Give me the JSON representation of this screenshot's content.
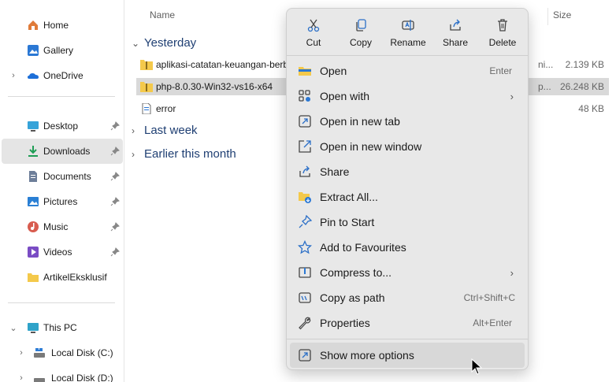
{
  "sidebar": {
    "items": [
      {
        "label": "Home",
        "icon": "home-icon"
      },
      {
        "label": "Gallery",
        "icon": "gallery-icon"
      },
      {
        "label": "OneDrive",
        "icon": "onedrive-icon"
      },
      {
        "label": "Desktop",
        "icon": "desktop-icon"
      },
      {
        "label": "Downloads",
        "icon": "downloads-icon"
      },
      {
        "label": "Documents",
        "icon": "documents-icon"
      },
      {
        "label": "Pictures",
        "icon": "pictures-icon"
      },
      {
        "label": "Music",
        "icon": "music-icon"
      },
      {
        "label": "Videos",
        "icon": "videos-icon"
      },
      {
        "label": "ArtikelEksklusif",
        "icon": "folder-icon"
      },
      {
        "label": "This PC",
        "icon": "this-pc-icon"
      },
      {
        "label": "Local Disk (C:)",
        "icon": "drive-icon"
      },
      {
        "label": "Local Disk (D:)",
        "icon": "drive-icon"
      }
    ]
  },
  "content": {
    "columns": {
      "name": "Name",
      "size": "Size"
    },
    "groups": [
      {
        "label": "Yesterday"
      },
      {
        "label": "Last week"
      },
      {
        "label": "Earlier this month"
      }
    ],
    "files": [
      {
        "name": "aplikasi-catatan-keuangan-berb",
        "type": "ni...",
        "size": "2.139 KB"
      },
      {
        "name": "php-8.0.30-Win32-vs16-x64",
        "type": "p...",
        "size": "26.248 KB"
      },
      {
        "name": "error",
        "type": "",
        "size": "48 KB"
      }
    ]
  },
  "menu": {
    "quick": [
      {
        "label": "Cut",
        "icon": "scissors-icon"
      },
      {
        "label": "Copy",
        "icon": "copy-icon"
      },
      {
        "label": "Rename",
        "icon": "rename-icon"
      },
      {
        "label": "Share",
        "icon": "share-icon"
      },
      {
        "label": "Delete",
        "icon": "trash-icon"
      }
    ],
    "items": [
      {
        "label": "Open",
        "shortcut": "Enter",
        "icon": "open-folder-icon"
      },
      {
        "label": "Open with",
        "icon": "open-with-icon",
        "submenu": true
      },
      {
        "label": "Open in new tab",
        "icon": "new-tab-icon"
      },
      {
        "label": "Open in new window",
        "icon": "new-window-icon"
      },
      {
        "label": "Share",
        "icon": "share-icon"
      },
      {
        "label": "Extract All...",
        "icon": "extract-icon"
      },
      {
        "label": "Pin to Start",
        "icon": "pin-icon"
      },
      {
        "label": "Add to Favourites",
        "icon": "star-icon"
      },
      {
        "label": "Compress to...",
        "icon": "compress-icon",
        "submenu": true
      },
      {
        "label": "Copy as path",
        "shortcut": "Ctrl+Shift+C",
        "icon": "copy-path-icon"
      },
      {
        "label": "Properties",
        "shortcut": "Alt+Enter",
        "icon": "wrench-icon"
      },
      {
        "label": "Show more options",
        "icon": "more-options-icon"
      }
    ],
    "submenu_arrow": "›"
  },
  "colors": {
    "accent": "#0067c0",
    "folder": "#f4c94b",
    "menu_bg": "#e8e8e8",
    "selection": "#d9d9d9"
  }
}
